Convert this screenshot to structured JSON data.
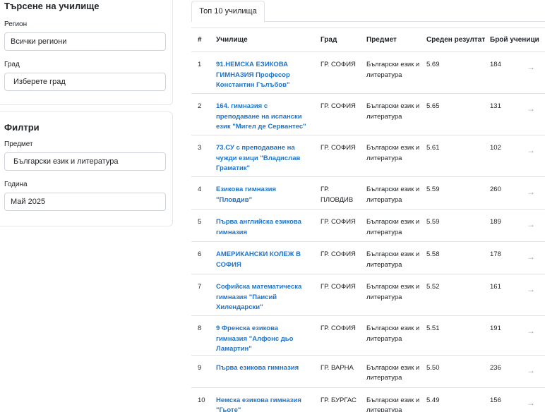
{
  "search": {
    "title": "Търсене на училище",
    "region_label": "Регион",
    "region_value": "Всички региони",
    "city_label": "Град",
    "city_value": "Изберете град"
  },
  "filters": {
    "title": "Филтри",
    "subject_label": "Предмет",
    "subject_value": "Български език и литература",
    "year_label": "Година",
    "year_value": "Май 2025"
  },
  "tab": {
    "label": "Топ 10 училища"
  },
  "table": {
    "headers": {
      "num": "#",
      "school": "Училище",
      "city": "Град",
      "subject": "Предмет",
      "avg": "Среден резултат",
      "count": "Брой ученици"
    },
    "arrow_icon": "→",
    "rows": [
      {
        "num": "1",
        "school": "91.НЕМСКА ЕЗИКОВА ГИМНАЗИЯ Професор Константин Гълъбов\"",
        "city": "ГР. СОФИЯ",
        "subject": "Български език и литература",
        "avg": "5.69",
        "count": "184"
      },
      {
        "num": "2",
        "school": "164. гимназия с преподаване на испански език \"Мигел де Сервантес\"",
        "city": "ГР. СОФИЯ",
        "subject": "Български език и литература",
        "avg": "5.65",
        "count": "131"
      },
      {
        "num": "3",
        "school": "73.СУ с преподаване на чужди езици \"Владислав Граматик\"",
        "city": "ГР. СОФИЯ",
        "subject": "Български език и литература",
        "avg": "5.61",
        "count": "102"
      },
      {
        "num": "4",
        "school": "Езикова гимназия \"Пловдив\"",
        "city": "ГР. ПЛОВДИВ",
        "subject": "Български език и литература",
        "avg": "5.59",
        "count": "260"
      },
      {
        "num": "5",
        "school": "Първа английска езикова гимназия",
        "city": "ГР. СОФИЯ",
        "subject": "Български език и литература",
        "avg": "5.59",
        "count": "189"
      },
      {
        "num": "6",
        "school": "АМЕРИКАНСКИ КОЛЕЖ В СОФИЯ",
        "city": "ГР. СОФИЯ",
        "subject": "Български език и литература",
        "avg": "5.58",
        "count": "178"
      },
      {
        "num": "7",
        "school": "Софийска математическа гимназия \"Паисий Хилендарски\"",
        "city": "ГР. СОФИЯ",
        "subject": "Български език и литература",
        "avg": "5.52",
        "count": "161"
      },
      {
        "num": "8",
        "school": "9 Френска езикова гимназия \"Алфонс дьо Ламартин\"",
        "city": "ГР. СОФИЯ",
        "subject": "Български език и литература",
        "avg": "5.51",
        "count": "191"
      },
      {
        "num": "9",
        "school": "Първа езикова гимназия",
        "city": "ГР. ВАРНА",
        "subject": "Български език и литература",
        "avg": "5.50",
        "count": "236"
      },
      {
        "num": "10",
        "school": "Немска езикова гимназия \"Гьоте\"",
        "city": "ГР. БУРГАС",
        "subject": "Български език и литература",
        "avg": "5.49",
        "count": "156"
      }
    ]
  }
}
